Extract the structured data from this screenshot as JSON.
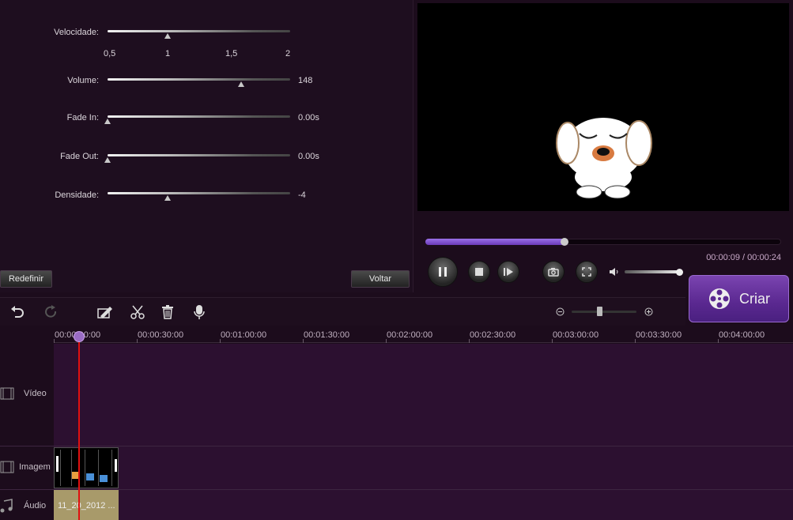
{
  "sliders": {
    "speed": {
      "label": "Velocidade:",
      "ticks": [
        "0,5",
        "1",
        "1,5",
        "2"
      ],
      "value": 0.33
    },
    "volume": {
      "label": "Volume:",
      "value_text": "148",
      "value": 0.73
    },
    "fade_in": {
      "label": "Fade In:",
      "value_text": "0.00s",
      "value": 0
    },
    "fade_out": {
      "label": "Fade Out:",
      "value_text": "0.00s",
      "value": 0
    },
    "density": {
      "label": "Densidade:",
      "value_text": "-4",
      "value": 0.33
    }
  },
  "buttons": {
    "reset": "Redefinir",
    "back": "Voltar",
    "create": "Criar"
  },
  "player": {
    "time": "00:00:09 / 00:00:24",
    "progress": 0.39,
    "volume": 0.95
  },
  "toolbar": {
    "icons": [
      "undo-icon",
      "redo-icon",
      "edit-icon",
      "cut-icon",
      "delete-icon",
      "microphone-icon"
    ],
    "zoom_level": 0.4
  },
  "ruler": [
    "00:00:00:00",
    "00:00:30:00",
    "00:01:00:00",
    "00:01:30:00",
    "00:02:00:00",
    "00:02:30:00",
    "00:03:00:00",
    "00:03:30:00",
    "00:04:00:00"
  ],
  "tracks": {
    "video": "Vídeo",
    "image": "Imagem",
    "audio": "Áudio"
  },
  "clips": {
    "audio": "11_20_2012 ..."
  },
  "colors": {
    "accent": "#7a44b0",
    "playhead": "#e01010",
    "audio_clip": "#a89a6a"
  }
}
